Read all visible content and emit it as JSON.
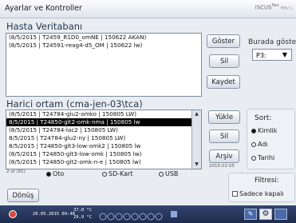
{
  "window": {
    "title": "Ayarlar ve Kontroller",
    "brand": "iSCUS",
    "brand_sup": "flex",
    "brand_rev": "Rev L"
  },
  "patient_db": {
    "title": "Hasta Veritabanı",
    "items": [
      "(8/5/2015 | T2459_R1D0_omNE | 150622 AKAN)",
      "(8/5/2015 | T24591-reag4-d5_OM | 150622 lw)"
    ],
    "buttons": {
      "show": "Göster",
      "delete": "Sil",
      "save": "Kaydet"
    },
    "show_here_label": "Burada göster",
    "dropdown_value": "P3:"
  },
  "external_media": {
    "title": "Harici ortam (cma-jen-03\\tca)",
    "items": [
      {
        "text": "(8/5/2015 | T24784-glu2-omko | 150805 LW)",
        "selected": false
      },
      {
        "text": "8/5/2015 | T24850-glt2-omk-nma | 150805 lw",
        "selected": true
      },
      {
        "text": "(8/5/2015 | T24784-lac2 | 150805 LW)",
        "selected": false
      },
      {
        "text": "8/5/2015 | T24784-glu2-ny | 150805 LW)",
        "selected": false
      },
      {
        "text": "8/5/2015 | T24850-glt3-low-omk2 | 150805 lw",
        "selected": false
      },
      {
        "text": "(8/5/2015 | T24850-glt3-low-omk | 150805 lw)",
        "selected": false
      },
      {
        "text": "(8/5/2015 | T24850-glt2-omk-n-e | 150805 lw)",
        "selected": false
      }
    ],
    "count": "2 of (91)",
    "source_options": {
      "auto": "Oto",
      "sd": "SD-Kart",
      "usb": "USB"
    },
    "buttons": {
      "load": "Yükle",
      "delete": "Sil",
      "archive": "Arşiv"
    },
    "archive_date": "2015-02-05"
  },
  "sort": {
    "title": "Sort:",
    "options": {
      "id": "Kimlik",
      "name": "Adı",
      "date": "Tarihi"
    }
  },
  "filter": {
    "title": "Filtresi:",
    "only_closed": "Sadece kapalı"
  },
  "back_button": "Dönüş",
  "taskbar": {
    "datetime": "20.05.2015 09:48",
    "temp_top": "37,0 °C",
    "temp_bottom": "29,9 °C"
  }
}
